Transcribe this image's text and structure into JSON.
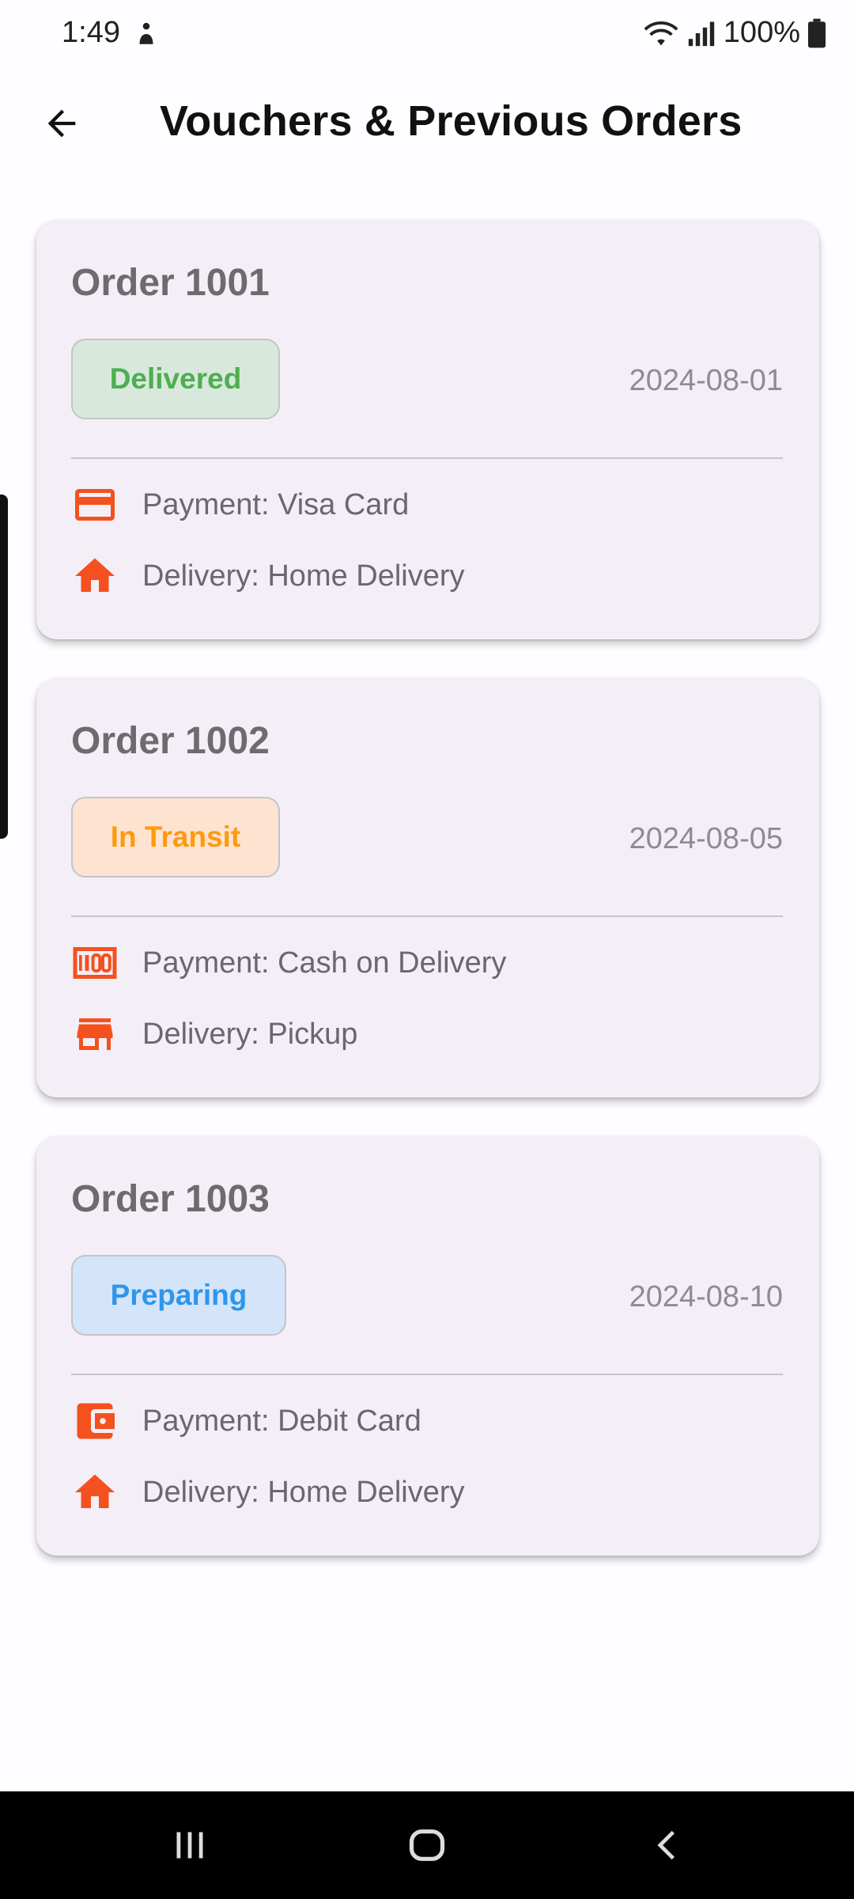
{
  "status_bar": {
    "time": "1:49",
    "battery": "100%"
  },
  "app_bar": {
    "title": "Vouchers & Previous Orders"
  },
  "orders": [
    {
      "title": "Order 1001",
      "status": "Delivered",
      "status_color": "#4caf50",
      "date": "2024-08-01",
      "payment": "Payment: Visa Card",
      "payment_icon": "credit-card-icon",
      "delivery": "Delivery: Home Delivery",
      "delivery_icon": "home-icon"
    },
    {
      "title": "Order 1002",
      "status": "In Transit",
      "status_color": "#ff9a0e",
      "date": "2024-08-05",
      "payment": "Payment: Cash on Delivery",
      "payment_icon": "cash-icon",
      "delivery": "Delivery: Pickup",
      "delivery_icon": "store-icon"
    },
    {
      "title": "Order 1003",
      "status": "Preparing",
      "status_color": "#2f96ea",
      "date": "2024-08-10",
      "payment": "Payment: Debit Card",
      "payment_icon": "wallet-icon",
      "delivery": "Delivery: Home Delivery",
      "delivery_icon": "home-icon"
    }
  ],
  "colors": {
    "accent_icon": "#f4511e",
    "card_background": "#f4eff7"
  }
}
